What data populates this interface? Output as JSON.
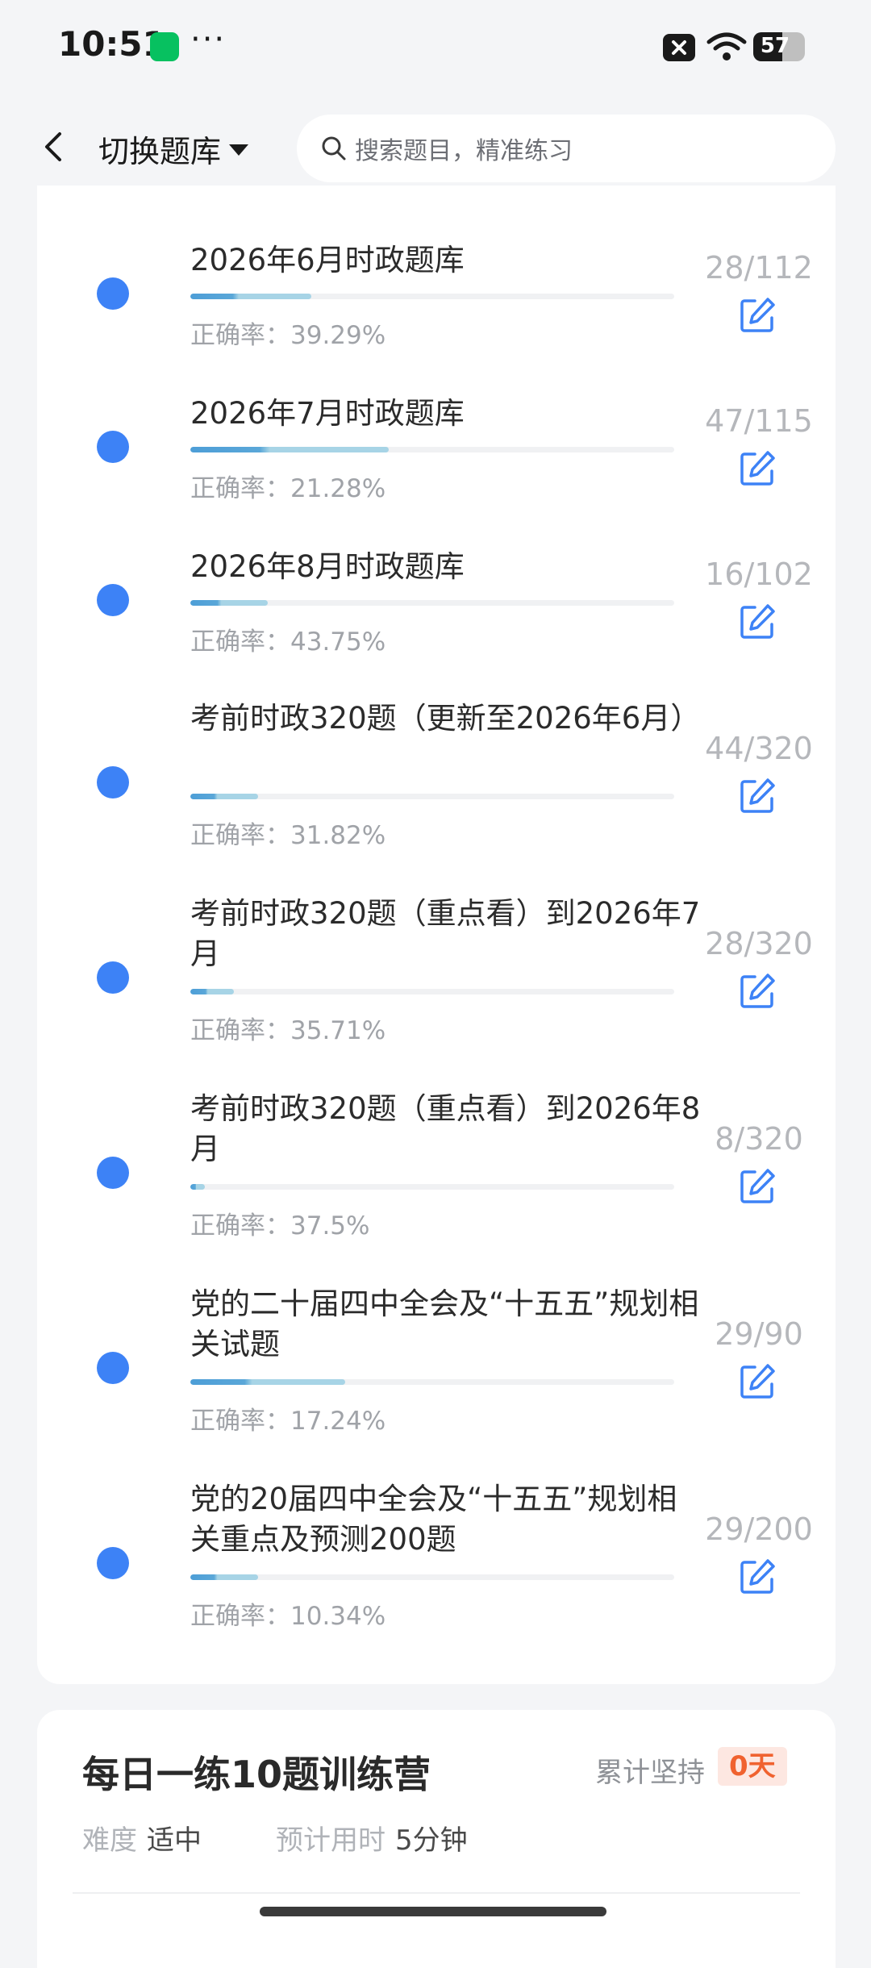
{
  "status_bar": {
    "time": "10:51",
    "more": "···",
    "battery": "57"
  },
  "header": {
    "switch_label": "切换题库",
    "search_placeholder": "搜索题目，精准练习"
  },
  "items": [
    {
      "title": "2026年6月时政题库",
      "progress": 0.25,
      "accuracy": "正确率：39.29%",
      "count": "28/112"
    },
    {
      "title": "2026年7月时政题库",
      "progress": 0.41,
      "accuracy": "正确率：21.28%",
      "count": "47/115"
    },
    {
      "title": "2026年8月时政题库",
      "progress": 0.16,
      "accuracy": "正确率：43.75%",
      "count": "16/102"
    },
    {
      "title": "考前时政320题（更新至2026年6月）",
      "progress": 0.14,
      "accuracy": "正确率：31.82%",
      "count": "44/320"
    },
    {
      "title": "考前时政320题（重点看）到2026年7月",
      "progress": 0.09,
      "accuracy": "正确率：35.71%",
      "count": "28/320"
    },
    {
      "title": "考前时政320题（重点看）到2026年8月",
      "progress": 0.03,
      "accuracy": "正确率：37.5%",
      "count": "8/320"
    },
    {
      "title": "党的二十届四中全会及“十五五”规划相关试题",
      "progress": 0.32,
      "accuracy": "正确率：17.24%",
      "count": "29/90"
    },
    {
      "title": "党的20届四中全会及“十五五”规划相关重点及预测200题",
      "progress": 0.14,
      "accuracy": "正确率：10.34%",
      "count": "29/200"
    }
  ],
  "camp": {
    "title": "每日一练10题训练营",
    "streak_label": "累计坚持",
    "streak_value": "0天",
    "difficulty_label": "难度",
    "difficulty_value": "适中",
    "time_label": "预计用时",
    "time_value": "5分钟"
  },
  "colors": {
    "accent": "#3d82f6",
    "streak": "#f0622f"
  }
}
